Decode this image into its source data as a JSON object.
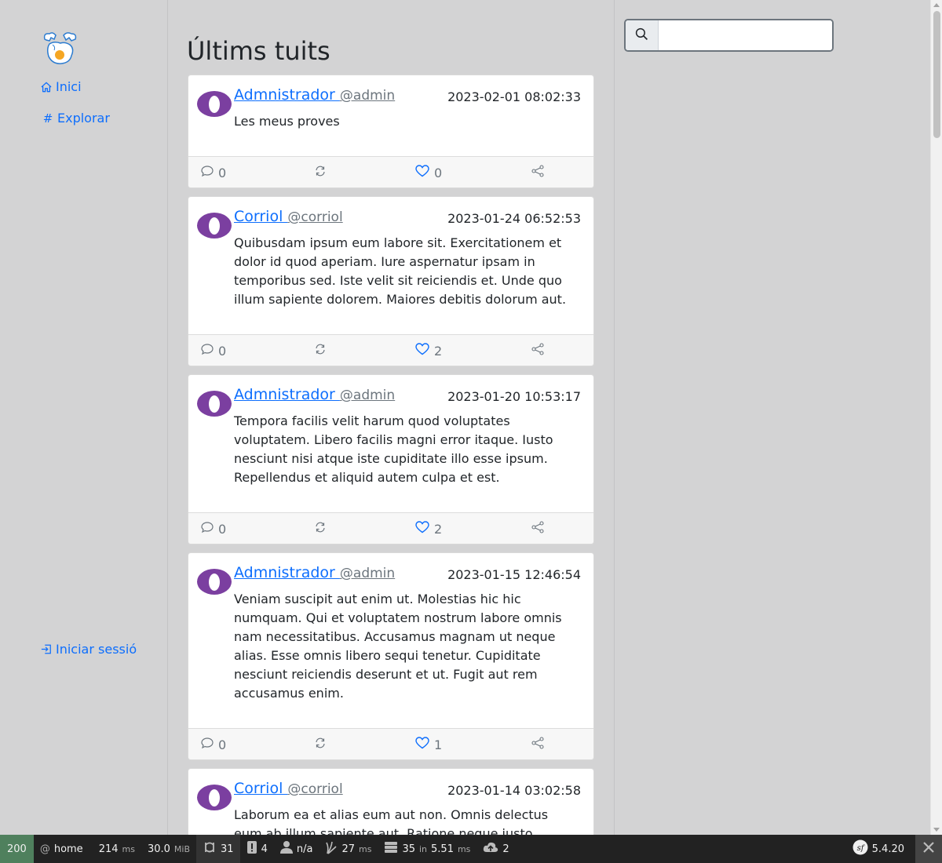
{
  "sidebar": {
    "logo_icon": "fried-egg-logo",
    "nav": [
      {
        "label": "Inici",
        "icon": "home-icon"
      },
      {
        "label": "Explorar",
        "icon": "hash-icon",
        "glyph": "#"
      }
    ],
    "login": {
      "label": "Iniciar sessió",
      "icon": "login-icon"
    }
  },
  "main": {
    "title": "Últims tuits",
    "tweets": [
      {
        "author": "Admnistrador ",
        "handle": "@admin",
        "date": "2023-02-01 08:02:33",
        "text": "Les meus proves",
        "comments": "0",
        "likes": "0"
      },
      {
        "author": "Corriol ",
        "handle": "@corriol",
        "date": "2023-01-24 06:52:53",
        "text": "Quibusdam ipsum eum labore sit. Exercitationem et dolor id quod aperiam. Iure aspernatur ipsam in temporibus sed. Iste velit sit reiciendis et. Unde quo illum sapiente dolorem. Maiores debitis dolorum aut.",
        "comments": "0",
        "likes": "2"
      },
      {
        "author": "Admnistrador ",
        "handle": "@admin",
        "date": "2023-01-20 10:53:17",
        "text": "Tempora facilis velit harum quod voluptates voluptatem. Libero facilis magni error itaque. Iusto nesciunt nisi atque iste cupiditate illo esse ipsum. Repellendus et aliquid autem culpa et est.",
        "comments": "0",
        "likes": "2"
      },
      {
        "author": "Admnistrador ",
        "handle": "@admin",
        "date": "2023-01-15 12:46:54",
        "text": "Veniam suscipit aut enim ut. Molestias hic hic numquam. Qui et voluptatem nostrum labore omnis nam necessitatibus. Accusamus magnam ut neque alias. Esse omnis libero sequi tenetur. Cupiditate nesciunt reiciendis deserunt et ut. Fugit aut rem accusamus enim.",
        "comments": "0",
        "likes": "1"
      },
      {
        "author": "Corriol ",
        "handle": "@corriol",
        "date": "2023-01-14 03:02:58",
        "text": "Laborum ea et alias eum aut non. Omnis delectus eum ab illum sapiente aut. Ratione neque iusto",
        "comments": "",
        "likes": ""
      }
    ]
  },
  "search": {
    "placeholder": "",
    "value": ""
  },
  "colors": {
    "background": "#d3d3d4",
    "link": "#0d6efd",
    "avatar": "#7b3fa0",
    "toolbar": "#222222",
    "status_ok": "#4f805d"
  },
  "toolbar": {
    "status": "200",
    "route_at": "@",
    "route": "home",
    "time": "214",
    "time_unit": "ms",
    "memory": "30.0",
    "memory_unit": "MiB",
    "requests": "31",
    "logs": "4",
    "user": "n/a",
    "twig_time": "27",
    "twig_unit": "ms",
    "db_queries": "35",
    "db_in": "in",
    "db_time": "5.51",
    "db_unit": "ms",
    "uploads": "2",
    "version": "5.4.20"
  }
}
